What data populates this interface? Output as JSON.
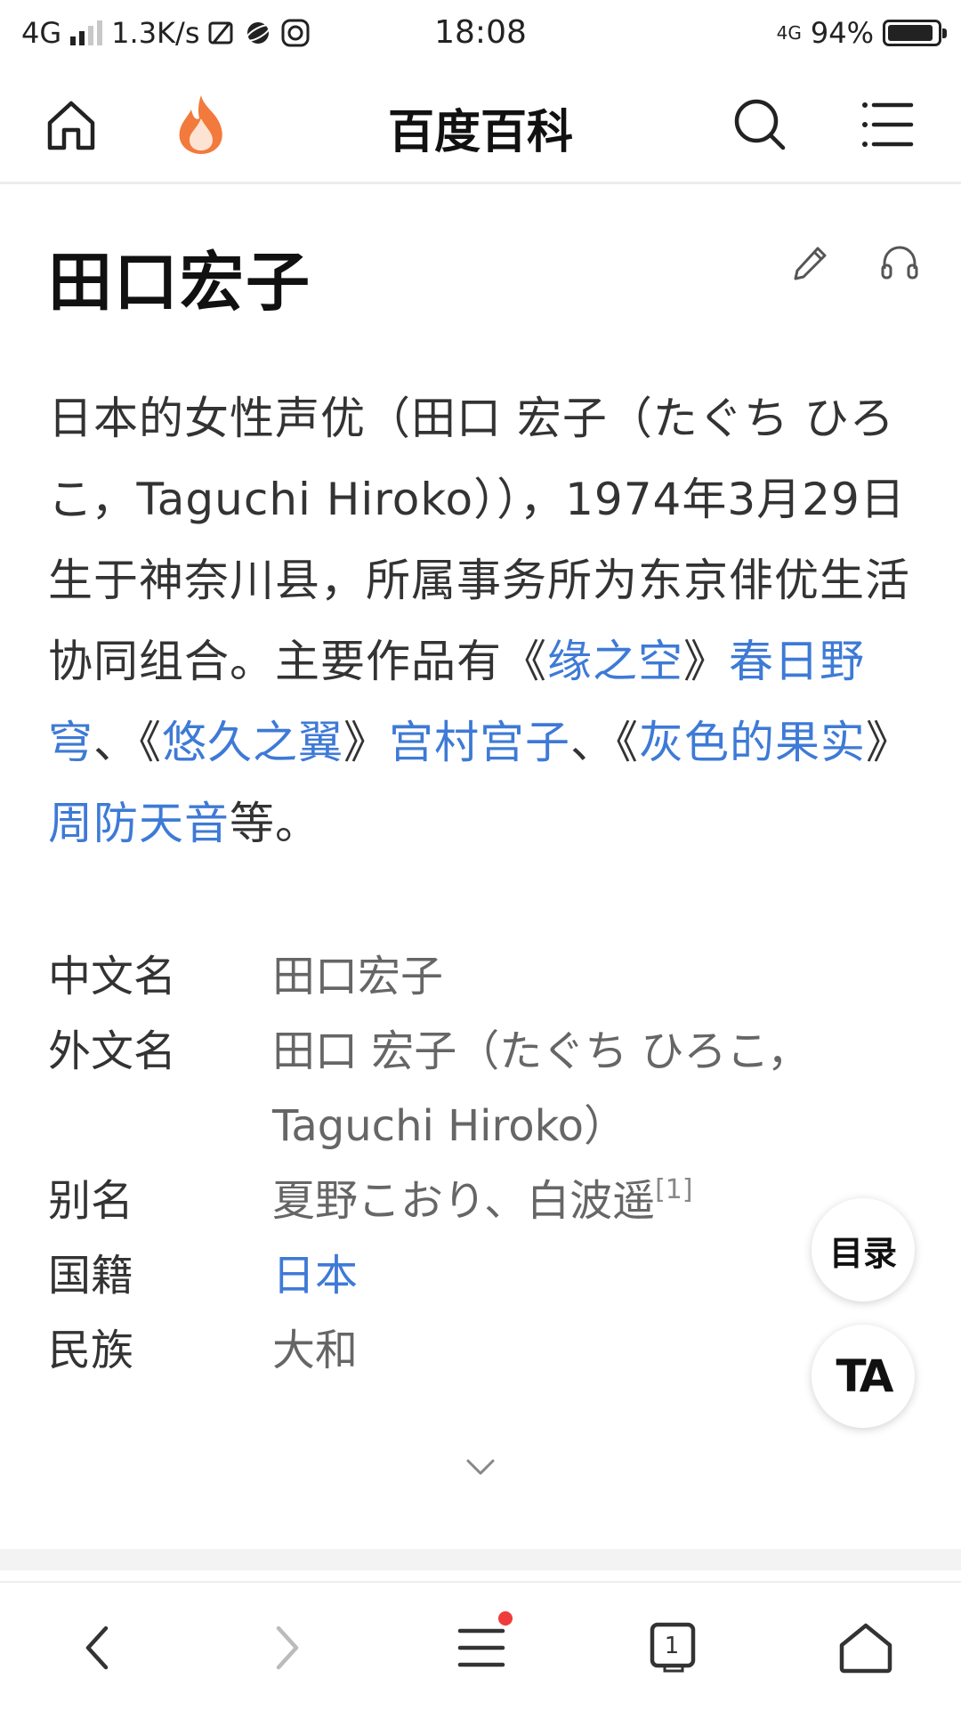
{
  "status_bar": {
    "network": "4G",
    "speed": "1.3K/s",
    "time": "18:08",
    "net_right": "4G",
    "battery": "94%",
    "battery_level": 0.94
  },
  "nav": {
    "title": "百度百科"
  },
  "entry": {
    "title": "田口宏子"
  },
  "summary": {
    "p1": "日本的女性声优（田口 宏子（たぐち ひろこ，Taguchi Hiroko）），1974年3月29日生于神奈川县，所属事务所为东京俳优生活协同组合。主要作品有《",
    "link1": "缘之空",
    "p2": "》",
    "link2": "春日野穹",
    "p3": "、《",
    "link3": "悠久之翼",
    "p4": "》",
    "link4": "宫村宫子",
    "p5": "、《",
    "link5": "灰色的果实",
    "p6": "》",
    "link6": "周防天音",
    "p7": "等。"
  },
  "info": [
    {
      "label": "中文名",
      "value": "田口宏子"
    },
    {
      "label": "外文名",
      "value": "田口 宏子（たぐち ひろこ，Taguchi Hiroko）"
    },
    {
      "label": "别名",
      "value": "夏野こおり、白波遥",
      "ref": "[1]"
    },
    {
      "label": "国籍",
      "value": "日本"
    },
    {
      "label": "民族",
      "value": "大和"
    }
  ],
  "float": {
    "toc_label": "目录",
    "font_label": "TA"
  },
  "bottom_bar": {
    "tabs_count": "1"
  },
  "colors": {
    "link": "#3e7ad6",
    "flame": "#f27a3d",
    "badge": "#f03b3b"
  }
}
